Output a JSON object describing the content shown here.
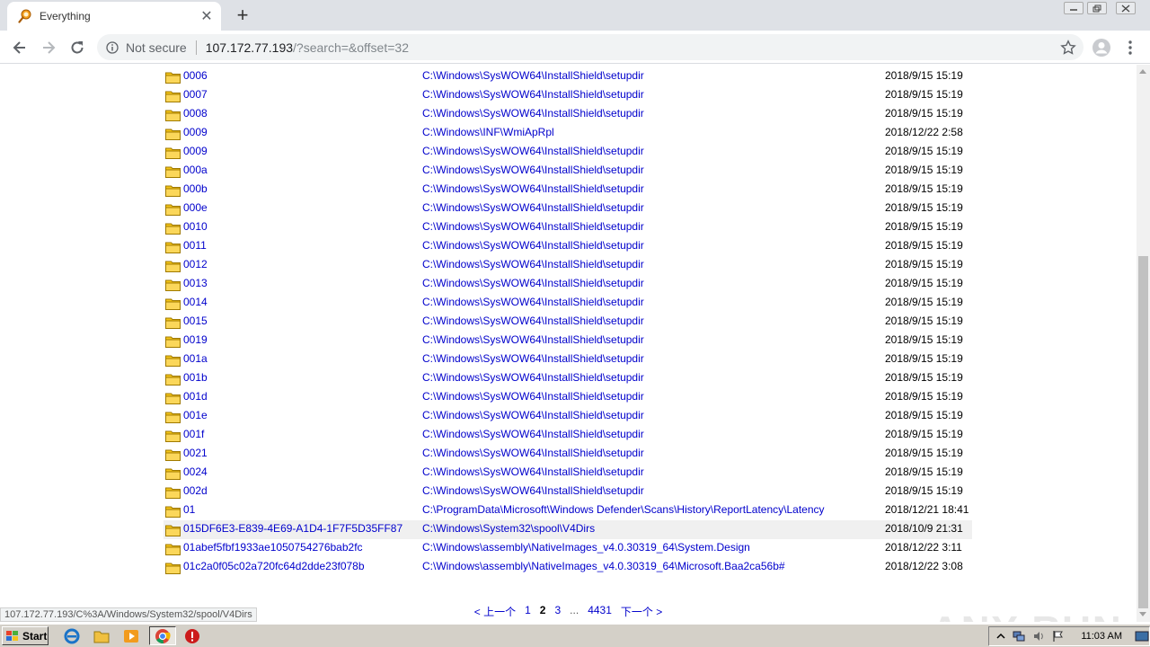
{
  "browser": {
    "tab_title": "Everything",
    "security_label": "Not secure",
    "url_host": "107.172.77.193",
    "url_rest": "/?search=&offset=32",
    "new_tab_label": "+",
    "tab_close_label": "✕"
  },
  "rows": [
    {
      "name": "0006",
      "path": "C:\\Windows\\SysWOW64\\InstallShield\\setupdir",
      "date": "2018/9/15 15:19"
    },
    {
      "name": "0007",
      "path": "C:\\Windows\\SysWOW64\\InstallShield\\setupdir",
      "date": "2018/9/15 15:19"
    },
    {
      "name": "0008",
      "path": "C:\\Windows\\SysWOW64\\InstallShield\\setupdir",
      "date": "2018/9/15 15:19"
    },
    {
      "name": "0009",
      "path": "C:\\Windows\\INF\\WmiApRpl",
      "date": "2018/12/22 2:58"
    },
    {
      "name": "0009",
      "path": "C:\\Windows\\SysWOW64\\InstallShield\\setupdir",
      "date": "2018/9/15 15:19"
    },
    {
      "name": "000a",
      "path": "C:\\Windows\\SysWOW64\\InstallShield\\setupdir",
      "date": "2018/9/15 15:19"
    },
    {
      "name": "000b",
      "path": "C:\\Windows\\SysWOW64\\InstallShield\\setupdir",
      "date": "2018/9/15 15:19"
    },
    {
      "name": "000e",
      "path": "C:\\Windows\\SysWOW64\\InstallShield\\setupdir",
      "date": "2018/9/15 15:19"
    },
    {
      "name": "0010",
      "path": "C:\\Windows\\SysWOW64\\InstallShield\\setupdir",
      "date": "2018/9/15 15:19"
    },
    {
      "name": "0011",
      "path": "C:\\Windows\\SysWOW64\\InstallShield\\setupdir",
      "date": "2018/9/15 15:19"
    },
    {
      "name": "0012",
      "path": "C:\\Windows\\SysWOW64\\InstallShield\\setupdir",
      "date": "2018/9/15 15:19"
    },
    {
      "name": "0013",
      "path": "C:\\Windows\\SysWOW64\\InstallShield\\setupdir",
      "date": "2018/9/15 15:19"
    },
    {
      "name": "0014",
      "path": "C:\\Windows\\SysWOW64\\InstallShield\\setupdir",
      "date": "2018/9/15 15:19"
    },
    {
      "name": "0015",
      "path": "C:\\Windows\\SysWOW64\\InstallShield\\setupdir",
      "date": "2018/9/15 15:19"
    },
    {
      "name": "0019",
      "path": "C:\\Windows\\SysWOW64\\InstallShield\\setupdir",
      "date": "2018/9/15 15:19"
    },
    {
      "name": "001a",
      "path": "C:\\Windows\\SysWOW64\\InstallShield\\setupdir",
      "date": "2018/9/15 15:19"
    },
    {
      "name": "001b",
      "path": "C:\\Windows\\SysWOW64\\InstallShield\\setupdir",
      "date": "2018/9/15 15:19"
    },
    {
      "name": "001d",
      "path": "C:\\Windows\\SysWOW64\\InstallShield\\setupdir",
      "date": "2018/9/15 15:19"
    },
    {
      "name": "001e",
      "path": "C:\\Windows\\SysWOW64\\InstallShield\\setupdir",
      "date": "2018/9/15 15:19"
    },
    {
      "name": "001f",
      "path": "C:\\Windows\\SysWOW64\\InstallShield\\setupdir",
      "date": "2018/9/15 15:19"
    },
    {
      "name": "0021",
      "path": "C:\\Windows\\SysWOW64\\InstallShield\\setupdir",
      "date": "2018/9/15 15:19"
    },
    {
      "name": "0024",
      "path": "C:\\Windows\\SysWOW64\\InstallShield\\setupdir",
      "date": "2018/9/15 15:19"
    },
    {
      "name": "002d",
      "path": "C:\\Windows\\SysWOW64\\InstallShield\\setupdir",
      "date": "2018/9/15 15:19"
    },
    {
      "name": "01",
      "path": "C:\\ProgramData\\Microsoft\\Windows Defender\\Scans\\History\\ReportLatency\\Latency",
      "date": "2018/12/21 18:41"
    },
    {
      "name": "015DF6E3-E839-4E69-A1D4-1F7F5D35FF87",
      "path": "C:\\Windows\\System32\\spool\\V4Dirs",
      "date": "2018/10/9 21:31"
    },
    {
      "name": "01abef5fbf1933ae1050754276bab2fc",
      "path": "C:\\Windows\\assembly\\NativeImages_v4.0.30319_64\\System.Design",
      "date": "2018/12/22 3:11"
    },
    {
      "name": "01c2a0f05c02a720fc64d2dde23f078b",
      "path": "C:\\Windows\\assembly\\NativeImages_v4.0.30319_64\\Microsoft.Baa2ca56b#",
      "date": "2018/12/22 3:08"
    }
  ],
  "highlighted_row": 24,
  "pager": {
    "prev": "< 上一个",
    "pages": [
      "1",
      "2",
      "3"
    ],
    "current": "2",
    "ellipsis": "...",
    "last": "4431",
    "next": "下一个 >"
  },
  "status_url": "107.172.77.193/C%3A/Windows/System32/spool/V4Dirs",
  "watermark": "ANY RUN",
  "taskbar": {
    "start_label": "Start",
    "clock": "11:03 AM"
  },
  "colors": {
    "link": "#0000cc",
    "tabstrip": "#dee1e6",
    "taskbar": "#d4d0c8",
    "folder": "#f5c518"
  }
}
